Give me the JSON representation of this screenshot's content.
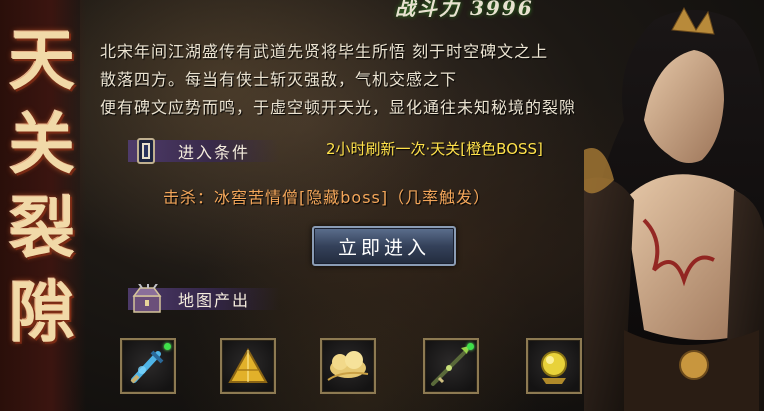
{
  "header": {
    "power_text": "战斗力 3996"
  },
  "title": {
    "chars": [
      "天",
      "关",
      "裂",
      "隙"
    ]
  },
  "description": {
    "lines": [
      "北宋年间江湖盛传有武道先贤将毕生所悟  刻于时空碑文之上",
      "散落四方。每当有侠士斩灭强敌，气机交感之下",
      "便有碑文应势而鸣，于虚空顿开天光，显化通往未知秘境的裂隙"
    ]
  },
  "entry_conditions": {
    "label": "进入条件",
    "refresh_note": "2小时刷新一次·天关[橙色BOSS]",
    "kill_requirement": "击杀：冰窖苦情僧[隐藏boss]（几率触发）"
  },
  "enter_button": {
    "label": "立即进入"
  },
  "map_drops": {
    "label": "地图产出",
    "items": [
      {
        "icon": "blue-sword-icon",
        "has_marker": true
      },
      {
        "icon": "gold-pyramid-icon",
        "has_marker": false
      },
      {
        "icon": "golden-cloud-icon",
        "has_marker": false
      },
      {
        "icon": "green-spear-icon",
        "has_marker": true
      },
      {
        "icon": "golden-orb-icon",
        "has_marker": false
      }
    ]
  },
  "colors": {
    "title": "#f1d9a8",
    "refresh_note": "#ffe14a",
    "kill_requirement": "#f3a65a",
    "button_bg": "#34415a",
    "slot_border": "#8d7a52"
  }
}
